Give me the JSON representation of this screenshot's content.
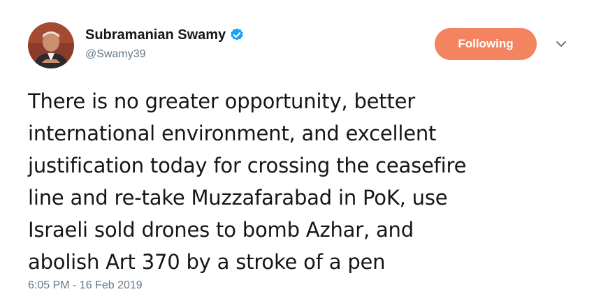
{
  "author": {
    "display_name": "Subramanian Swamy",
    "handle": "@Swamy39",
    "verified": true,
    "avatar_icon": "profile-photo"
  },
  "actions": {
    "follow_label": "Following",
    "follow_color": "#f4845f",
    "menu_icon": "chevron-down-icon"
  },
  "tweet": {
    "lines": [
      "There is no greater opportunity, better",
      "international environment, and excellent",
      "justification today for crossing the ceasefire",
      "line and re-take Muzzafarabad in PoK, use",
      "Israeli sold drones to bomb Azhar, and",
      "abolish Art 370 by a stroke of a pen"
    ],
    "timestamp": "6:05 PM - 16 Feb 2019"
  },
  "colors": {
    "text": "#14171a",
    "secondary": "#657786",
    "verified_blue": "#1da1f2"
  }
}
